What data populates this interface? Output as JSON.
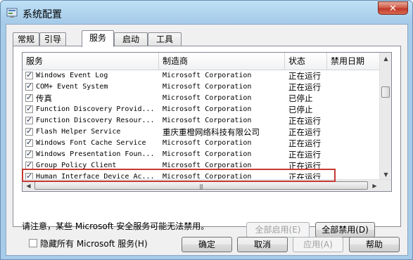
{
  "window": {
    "title": "系统配置",
    "close_label": "✕"
  },
  "tabs": [
    "常规",
    "引导",
    "服务",
    "启动",
    "工具"
  ],
  "active_tab": "服务",
  "columns": [
    "服务",
    "制造商",
    "状态",
    "禁用日期"
  ],
  "rows": [
    {
      "name": "Windows Event Log",
      "vendor": "Microsoft Corporation",
      "status": "正在运行",
      "checked": true
    },
    {
      "name": "COM+ Event System",
      "vendor": "Microsoft Corporation",
      "status": "正在运行",
      "checked": true
    },
    {
      "name": "传真",
      "vendor": "Microsoft Corporation",
      "status": "已停止",
      "checked": true
    },
    {
      "name": "Function Discovery Provid...",
      "vendor": "Microsoft Corporation",
      "status": "已停止",
      "checked": true
    },
    {
      "name": "Function Discovery Resour...",
      "vendor": "Microsoft Corporation",
      "status": "正在运行",
      "checked": true
    },
    {
      "name": "Flash Helper Service",
      "vendor": "重庆重橙网络科技有限公司",
      "status": "正在运行",
      "checked": true
    },
    {
      "name": "Windows Font Cache Service",
      "vendor": "Microsoft Corporation",
      "status": "正在运行",
      "checked": true
    },
    {
      "name": "Windows Presentation Foun...",
      "vendor": "Microsoft Corporation",
      "status": "正在运行",
      "checked": true
    },
    {
      "name": "Group Policy Client",
      "vendor": "Microsoft Corporation",
      "status": "正在运行",
      "checked": true
    },
    {
      "name": "Human Interface Device Ac...",
      "vendor": "Microsoft Corporation",
      "status": "正在运行",
      "checked": true
    }
  ],
  "note": "请注意，某些 Microsoft 安全服务可能无法禁用。",
  "enable_all": "全部启用(E)",
  "disable_all": "全部禁用(D)",
  "hide_ms": "隐藏所有 Microsoft 服务(H)",
  "buttons": {
    "ok": "确定",
    "cancel": "取消",
    "apply": "应用(A)",
    "help": "帮助"
  }
}
